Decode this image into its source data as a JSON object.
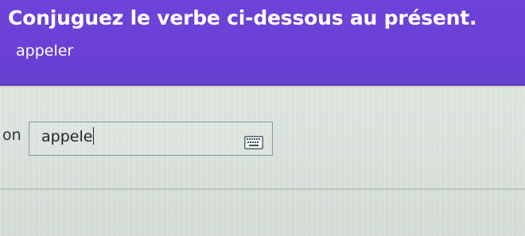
{
  "instruction": {
    "title": "Conjuguez le verbe ci-dessous au présent.",
    "verb": "appeler"
  },
  "answer": {
    "pronoun": "on",
    "value": "appele"
  },
  "icons": {
    "keyboard": "keyboard-icon"
  },
  "colors": {
    "header_background": "#6d43d8",
    "header_text": "#ffffff",
    "page_background": "#dfe7e1",
    "input_border": "#7f96a2"
  }
}
